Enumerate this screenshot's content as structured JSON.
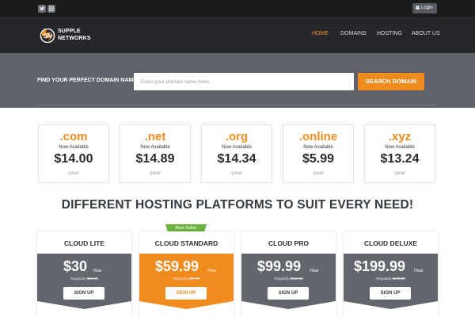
{
  "topbar": {
    "social": [
      "twitter-icon",
      "instagram-icon"
    ],
    "login_label": "Login"
  },
  "header": {
    "logo_line1": "SUPPLE",
    "logo_line2": "NETWORKS",
    "nav": [
      {
        "label": "HOME",
        "active": true
      },
      {
        "label": "DOMAINS",
        "active": false
      },
      {
        "label": "HOSTING",
        "active": false
      },
      {
        "label": "ABOUT US",
        "active": false
      }
    ]
  },
  "search": {
    "label": "FIND YOUR PERFECT DOMAIN NAME:",
    "placeholder": "Enter your domain name here...",
    "value": "",
    "button": "SEARCH DOMAIN"
  },
  "domains": [
    {
      "tld": ".com",
      "status": "Now Available",
      "price": "$14.00",
      "period": "/year"
    },
    {
      "tld": ".net",
      "status": "Now Available",
      "price": "$14.89",
      "period": "/year"
    },
    {
      "tld": ".org",
      "status": "Now Available",
      "price": "$14.34",
      "period": "/year"
    },
    {
      "tld": ".online",
      "status": "Now Available",
      "price": "$5.99",
      "period": "/year"
    },
    {
      "tld": ".xyz",
      "status": "Now Available",
      "price": "$13.24",
      "period": "/year"
    }
  ],
  "hosting": {
    "heading": "DIFFERENT HOSTING PLATFORMS TO SUIT EVERY NEED!",
    "badge": "Best Seller",
    "plans": [
      {
        "name": "CLOUD LITE",
        "price": "$30",
        "period": "/Year",
        "regular_label": "Regularly",
        "regular_price": "$35.99",
        "cta": "SIGN UP",
        "featured": false
      },
      {
        "name": "CLOUD STANDARD",
        "price": "$59.99",
        "period": "/Year",
        "regular_label": "Regularly",
        "regular_price": "$77.99",
        "cta": "SIGN UP",
        "featured": true
      },
      {
        "name": "CLOUD PRO",
        "price": "$99.99",
        "period": "/Year",
        "regular_label": "Regularly",
        "regular_price": "$119.88",
        "cta": "SIGN UP",
        "featured": false
      },
      {
        "name": "CLOUD DELUXE",
        "price": "$199.99",
        "period": "/Year",
        "regular_label": "Regularly",
        "regular_price": "$239.88",
        "cta": "SIGN UP",
        "featured": false
      }
    ]
  },
  "colors": {
    "accent": "#f08c1e",
    "topbar": "#1b1b1b",
    "header": "#26272a",
    "band": "#5f6369",
    "plan_block": "#63676d",
    "badge": "#6cb33f"
  }
}
